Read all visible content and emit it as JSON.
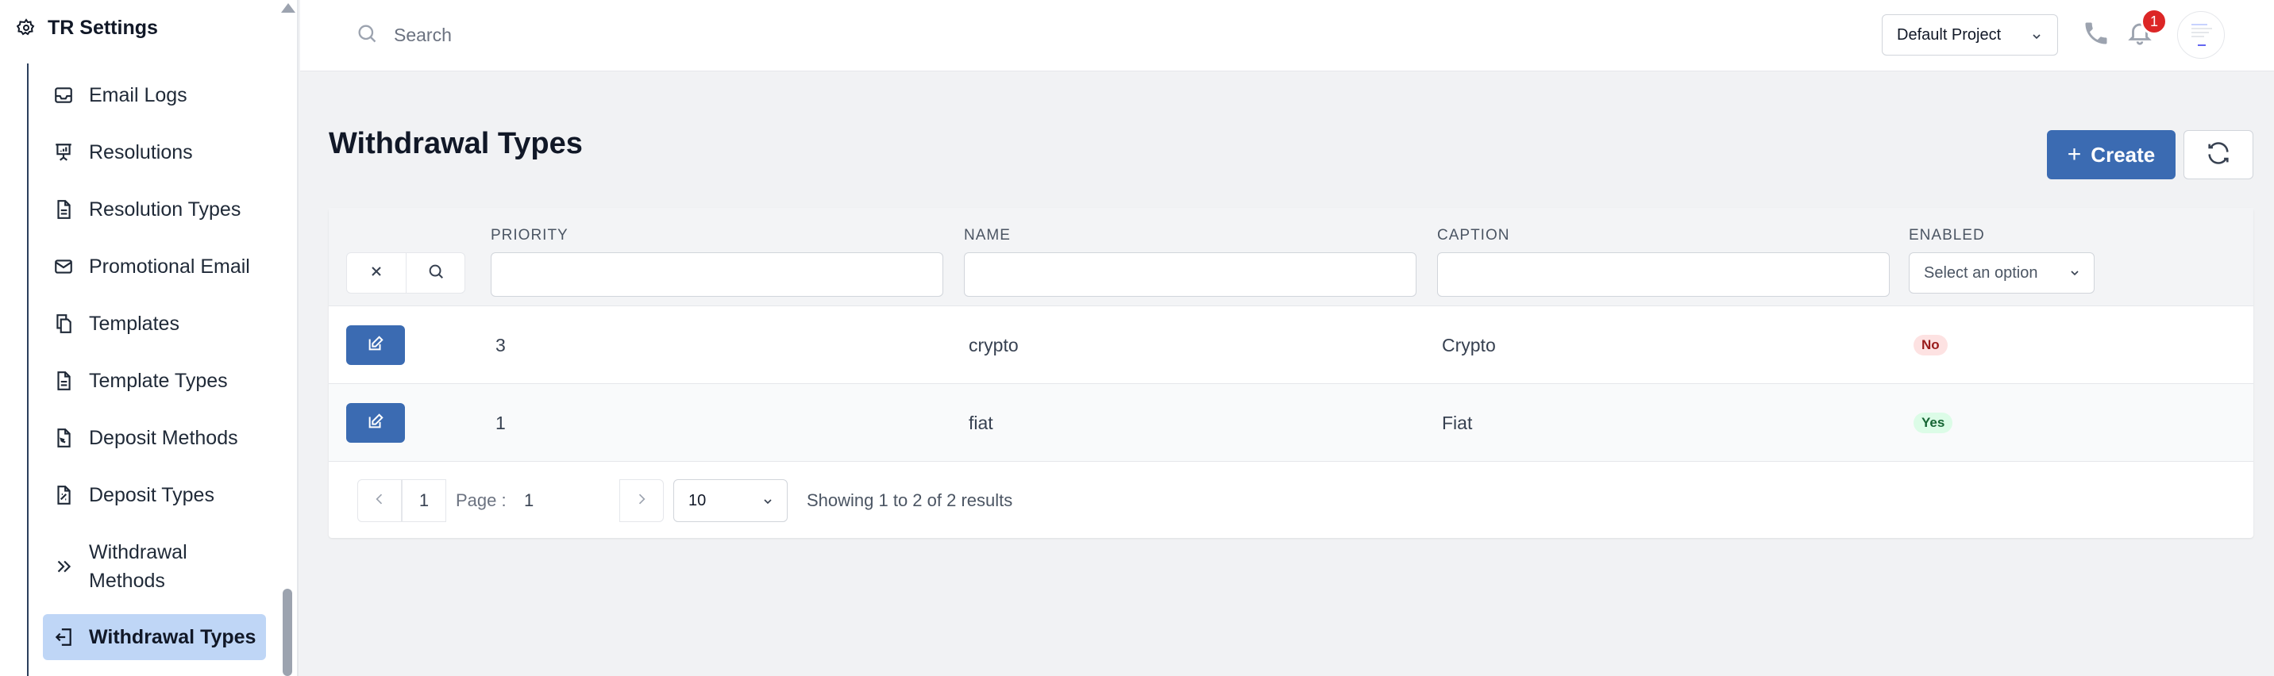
{
  "sidebar": {
    "title": "TR Settings",
    "items": [
      {
        "label": "Email Logs",
        "icon": "inbox-icon"
      },
      {
        "label": "Resolutions",
        "icon": "presentation-icon"
      },
      {
        "label": "Resolution Types",
        "icon": "document-icon"
      },
      {
        "label": "Promotional Email",
        "icon": "envelope-icon"
      },
      {
        "label": "Templates",
        "icon": "copy-icon"
      },
      {
        "label": "Template Types",
        "icon": "document-icon"
      },
      {
        "label": "Deposit Methods",
        "icon": "receipt-icon"
      },
      {
        "label": "Deposit Types",
        "icon": "receipt-icon"
      },
      {
        "label": "Withdrawal Methods",
        "icon": "chevrons-right-icon"
      },
      {
        "label": "Withdrawal Types",
        "icon": "logout-icon",
        "active": true
      }
    ]
  },
  "topbar": {
    "search_placeholder": "Search",
    "project": "Default Project",
    "notification_count": "1"
  },
  "main": {
    "title": "Withdrawal Types",
    "create_label": "Create"
  },
  "table": {
    "columns": [
      "PRIORITY",
      "NAME",
      "CAPTION",
      "ENABLED"
    ],
    "enabled_placeholder": "Select an option",
    "rows": [
      {
        "priority": "3",
        "name": "crypto",
        "caption": "Crypto",
        "enabled": "No"
      },
      {
        "priority": "1",
        "name": "fiat",
        "caption": "Fiat",
        "enabled": "Yes"
      }
    ]
  },
  "pagination": {
    "page_number": "1",
    "page_label": "Page :",
    "current_page": "1",
    "page_size": "10",
    "summary": "Showing 1 to 2 of 2 results"
  },
  "colors": {
    "primary": "#3b6bb2",
    "active_bg": "#bfd6f6",
    "badge": "#dc2626"
  }
}
